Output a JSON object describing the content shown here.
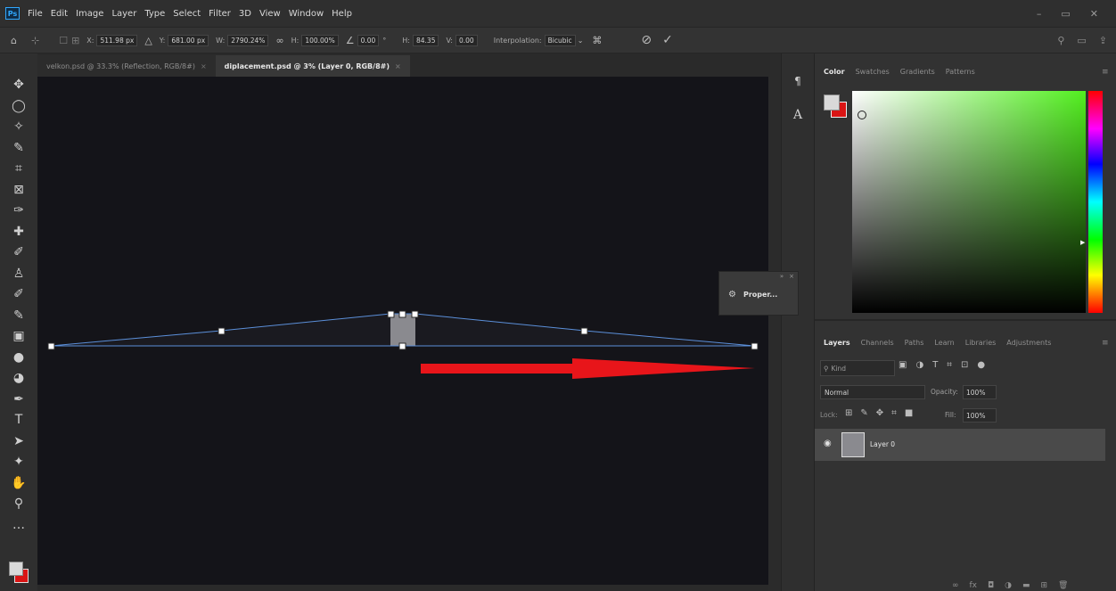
{
  "app": {
    "logo_text": "Ps"
  },
  "menu": {
    "items": [
      "File",
      "Edit",
      "Image",
      "Layer",
      "Type",
      "Select",
      "Filter",
      "3D",
      "View",
      "Window",
      "Help"
    ]
  },
  "window_controls": {
    "minimize": "–",
    "restore": "▭",
    "close": "✕"
  },
  "options_bar": {
    "x_label": "X:",
    "x_value": "511.98 px",
    "y_label": "Y:",
    "y_value": "681.00 px",
    "w_label": "W:",
    "w_value": "2790.24%",
    "h_label": "H:",
    "h_value": "100.00%",
    "angle_value": "0.00",
    "angle_unit": "°",
    "hskew_label": "H:",
    "hskew_value": "84.35",
    "vskew_label": "V:",
    "vskew_value": "0.00",
    "interpolation_label": "Interpolation:",
    "interpolation_value": "Bicubic"
  },
  "tabs": [
    {
      "label": "velkon.psd @ 33.3% (Reflection, RGB/8#)",
      "active": false
    },
    {
      "label": "diplacement.psd @ 3% (Layer 0, RGB/8#)",
      "active": true
    }
  ],
  "tools": [
    "move-tool",
    "lasso-tool",
    "magic-wand-tool",
    "quick-selection-tool",
    "crop-tool",
    "frame-tool",
    "eyedropper-tool",
    "healing-brush-tool",
    "brush-tool",
    "clone-stamp-tool",
    "history-brush-tool",
    "eraser-tool",
    "gradient-tool",
    "blur-tool",
    "dodge-tool",
    "pen-tool",
    "type-tool",
    "path-selection-tool",
    "shape-tool",
    "hand-tool",
    "zoom-tool",
    "more-tools"
  ],
  "tool_glyphs": [
    "✥",
    "◯",
    "✧",
    "✎",
    "⌗",
    "⊠",
    "✑",
    "✚",
    "✐",
    "♙",
    "✐",
    "✎",
    "▣",
    "●",
    "◕",
    "✒",
    "T",
    "➤",
    "✦",
    "✋",
    "⚲",
    "…"
  ],
  "properties_float": {
    "label": "Proper..."
  },
  "color_panel": {
    "tabs": [
      "Color",
      "Swatches",
      "Gradients",
      "Patterns"
    ],
    "active_tab": "Color",
    "hue_color": "#52ef1f",
    "foreground": "#d9d9d9",
    "background": "#d91414"
  },
  "layers_panel": {
    "tabs": [
      "Layers",
      "Channels",
      "Paths",
      "Learn",
      "Libraries",
      "Adjustments"
    ],
    "active_tab": "Layers",
    "filter_label": "Kind",
    "blend_mode": "Normal",
    "opacity_label": "Opacity:",
    "opacity_value": "100%",
    "lock_label": "Lock:",
    "fill_label": "Fill:",
    "fill_value": "100%",
    "layers": [
      {
        "name": "Layer 0",
        "visible": true
      }
    ]
  },
  "colors": {
    "arrow": "#e8151a",
    "transform_line": "#5b8fd9",
    "accent": "#31a8ff"
  }
}
